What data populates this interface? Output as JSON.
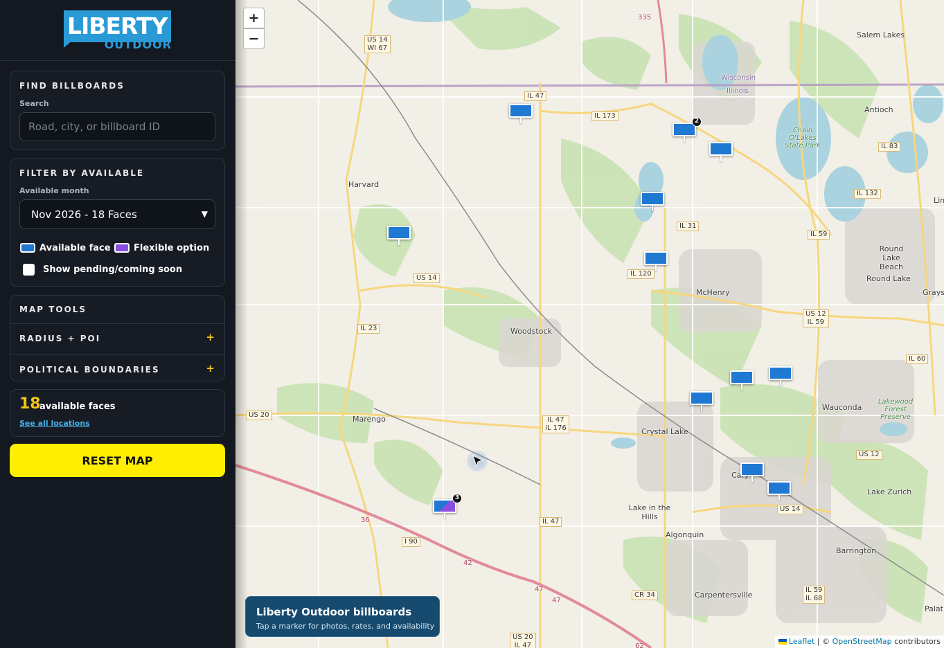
{
  "brand": {
    "name": "LIBERTY",
    "sub": "OUTDOOR"
  },
  "find": {
    "title": "FIND BILLBOARDS",
    "search_label": "Search",
    "search_placeholder": "Road, city, or billboard ID"
  },
  "filter": {
    "title": "FILTER BY AVAILABLE",
    "month_label": "Available month",
    "month_value": "Nov 2026 - 18 Faces",
    "legend_available": "Available face",
    "legend_flexible": "Flexible option",
    "pending_label": "Show pending/coming soon",
    "colors": {
      "available": "#1f78d1",
      "flexible": "#8a4fe0"
    }
  },
  "tools": {
    "title": "MAP TOOLS",
    "items": [
      {
        "label": "RADIUS + POI",
        "icon": "+"
      },
      {
        "label": "POLITICAL BOUNDARIES",
        "icon": "+"
      }
    ]
  },
  "summary": {
    "count": "18",
    "count_label": "available faces",
    "link": "See all locations"
  },
  "reset_label": "RESET MAP",
  "map": {
    "zoom_in": "+",
    "zoom_out": "−",
    "info_title": "Liberty Outdoor billboards",
    "info_sub": "Tap a marker for photos, rates, and availability",
    "attribution": {
      "leaflet": "Leaflet",
      "sep": " | © ",
      "osm": "OpenStreetMap",
      "contrib": " contributors"
    },
    "places": {
      "salem_lakes": "Salem Lakes",
      "antioch": "Antioch",
      "harvard": "Harvard",
      "woodstock": "Woodstock",
      "mchenry": "McHenry",
      "round_lake_beach": "Round Lake\nBeach",
      "round_lake": "Round Lake",
      "grays": "Grays",
      "lin": "Lin",
      "wauconda": "Wauconda",
      "crystal_lake": "Crystal Lake",
      "marengo": "Marengo",
      "cary": "Cary",
      "lake_in_the_hills": "Lake in the\nHills",
      "algonquin": "Algonquin",
      "lake_zurich": "Lake Zurich",
      "barrington": "Barrington",
      "carpentersville": "Carpentersville",
      "palati": "Palati",
      "chain_o_lakes": "Chain O'Lakes\nState Park",
      "lakewood": "Lakewood\nForest Preserve",
      "wisconsin": "Wisconsin",
      "illinois": "Illinois"
    },
    "shields": {
      "us14_wi67": "US 14\nWI 67",
      "il47_top": "IL 47",
      "il173": "IL 173",
      "il83": "IL 83",
      "il132": "IL 132",
      "il31": "IL 31",
      "il59_top": "IL 59",
      "il120": "IL 120",
      "us14_mid": "US 14",
      "us12_il59": "US 12\nIL 59",
      "il23": "IL 23",
      "il60": "IL 60",
      "us20": "US 20",
      "il47_il176": "IL 47\nIL 176",
      "us12": "US 12",
      "il47_low": "IL 47",
      "us14_low": "US 14",
      "i90": "I 90",
      "cr34": "CR 34",
      "il59_il68": "IL 59\nIL 68",
      "us20_il47": "US 20\nIL 47"
    },
    "route_nums": {
      "r335": "335",
      "r36": "36",
      "r42": "42",
      "r47a": "47",
      "r47b": "47",
      "r62": "62"
    },
    "markers": [
      {
        "badge": ""
      },
      {
        "badge": "2"
      },
      {
        "badge": ""
      },
      {
        "badge": ""
      },
      {
        "badge": ""
      },
      {
        "badge": ""
      },
      {
        "badge": ""
      },
      {
        "badge": ""
      },
      {
        "badge": ""
      },
      {
        "badge": ""
      },
      {
        "badge": ""
      },
      {
        "badge": ""
      },
      {
        "badge": "3"
      }
    ]
  }
}
